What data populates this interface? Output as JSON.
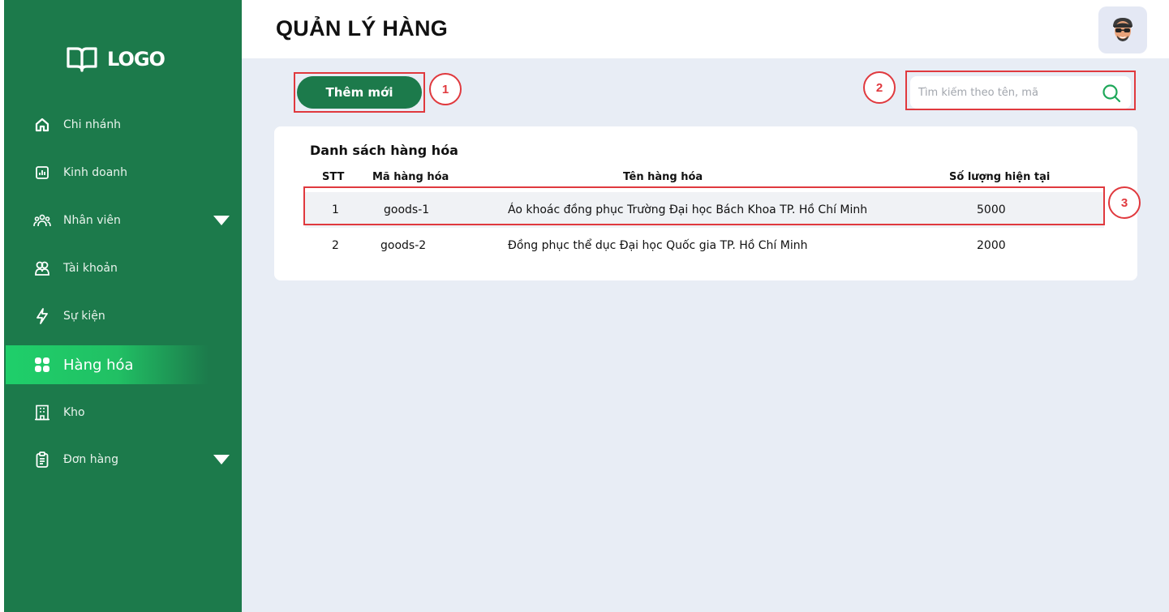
{
  "sidebar": {
    "logo_text": "LOGO",
    "items": [
      {
        "label": "Chi nhánh",
        "icon": "home-icon"
      },
      {
        "label": "Kinh doanh",
        "icon": "chart-icon"
      },
      {
        "label": "Nhân viên",
        "icon": "team-icon",
        "expandable": true
      },
      {
        "label": "Tài khoản",
        "icon": "users-icon"
      },
      {
        "label": "Sự kiện",
        "icon": "lightning-icon"
      },
      {
        "label": "Hàng hóa",
        "icon": "grid-icon",
        "active": true
      },
      {
        "label": "Kho",
        "icon": "building-icon"
      },
      {
        "label": "Đơn hàng",
        "icon": "clipboard-icon",
        "expandable": true
      }
    ]
  },
  "header": {
    "title": "QUẢN LÝ HÀNG"
  },
  "toolbar": {
    "add_label": "Thêm mới",
    "search_placeholder": "Tìm kiếm theo tên, mã"
  },
  "annotations": [
    "1",
    "2",
    "3"
  ],
  "table": {
    "title": "Danh sách hàng hóa",
    "columns": [
      "STT",
      "Mã hàng hóa",
      "Tên hàng hóa",
      "Số lượng hiện tại"
    ],
    "rows": [
      {
        "stt": "1",
        "code": "goods-1",
        "name": "Áo khoác đồng phục Trường Đại học Bách Khoa TP. Hồ Chí Minh",
        "qty": "5000"
      },
      {
        "stt": "2",
        "code": "goods-2",
        "name": "Đồng phục thể dục Đại học Quốc gia TP. Hồ Chí Minh",
        "qty": "2000"
      }
    ]
  },
  "colors": {
    "sidebar_bg": "#1c7a4b",
    "active_item": "#1fcf6a",
    "content_bg": "#e8edf5",
    "annotation_red": "#e0393e"
  }
}
